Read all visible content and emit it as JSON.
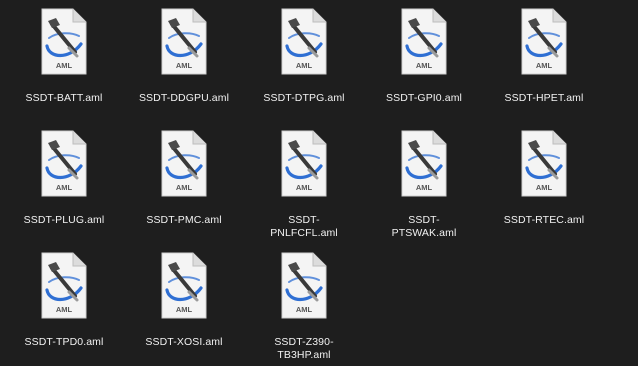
{
  "window": {
    "background": "#1e1e1e"
  },
  "icon": {
    "name": "aml-document-icon",
    "badge_text": "AML",
    "accent": "#2f6fd3",
    "paper": "#f4f4f4"
  },
  "files": [
    {
      "id": "ssdt-batt",
      "label": "SSDT-BATT.aml"
    },
    {
      "id": "ssdt-ddgpu",
      "label": "SSDT-DDGPU.aml"
    },
    {
      "id": "ssdt-dtpg",
      "label": "SSDT-DTPG.aml"
    },
    {
      "id": "ssdt-gpi0",
      "label": "SSDT-GPI0.aml"
    },
    {
      "id": "ssdt-hpet",
      "label": "SSDT-HPET.aml"
    },
    {
      "id": "ssdt-plug",
      "label": "SSDT-PLUG.aml"
    },
    {
      "id": "ssdt-pmc",
      "label": "SSDT-PMC.aml"
    },
    {
      "id": "ssdt-pnlfcfl",
      "label": "SSDT-\nPNLFCFL.aml"
    },
    {
      "id": "ssdt-ptswak",
      "label": "SSDT-\nPTSWAK.aml"
    },
    {
      "id": "ssdt-rtec",
      "label": "SSDT-RTEC.aml"
    },
    {
      "id": "ssdt-tpd0",
      "label": "SSDT-TPD0.aml"
    },
    {
      "id": "ssdt-xosi",
      "label": "SSDT-XOSI.aml"
    },
    {
      "id": "ssdt-z390-tb3hp",
      "label": "SSDT-Z390-\nTB3HP.aml"
    }
  ]
}
